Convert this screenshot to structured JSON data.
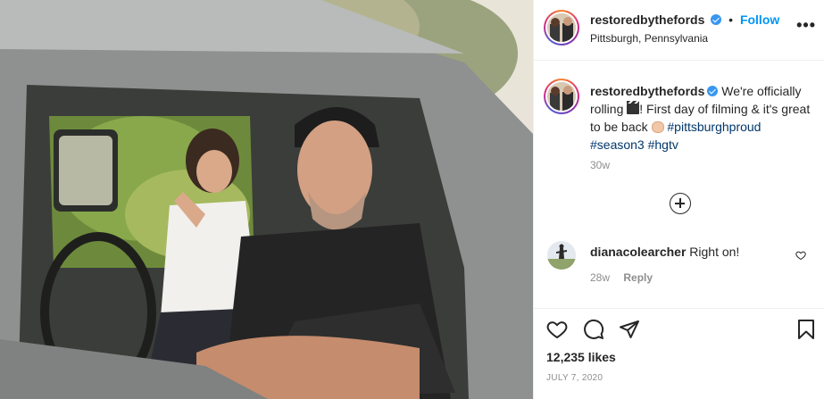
{
  "post": {
    "username": "restoredbythefords",
    "follow_label": "Follow",
    "separator": "•",
    "location": "Pittsburgh, Pennsylvania",
    "more_label": "•••",
    "caption": {
      "username": "restoredbythefords",
      "text_1": " We're officially rolling ",
      "text_2": "! First day of filming & it's great to be back ",
      "hashtags": [
        "#pittsburghproud",
        "#season3",
        "#hgtv"
      ],
      "time": "30w"
    },
    "comments": [
      {
        "username": "dianacolearcher",
        "text": "Right on!",
        "time": "28w",
        "reply_label": "Reply"
      }
    ],
    "likes": "12,235 likes",
    "date": "JULY 7, 2020"
  },
  "icons": {
    "verified": "verified-badge-icon",
    "like": "heart-icon",
    "comment": "comment-bubble-icon",
    "share": "paper-plane-icon",
    "save": "bookmark-icon",
    "load_more": "plus-circle-icon",
    "clapper": "clapper-board-emoji",
    "fist": "fist-bump-emoji"
  },
  "colors": {
    "link": "#0095f6",
    "hashtag": "#00376b",
    "muted": "#8e8e8e",
    "border": "#efefef",
    "verified": "#3897f0"
  }
}
